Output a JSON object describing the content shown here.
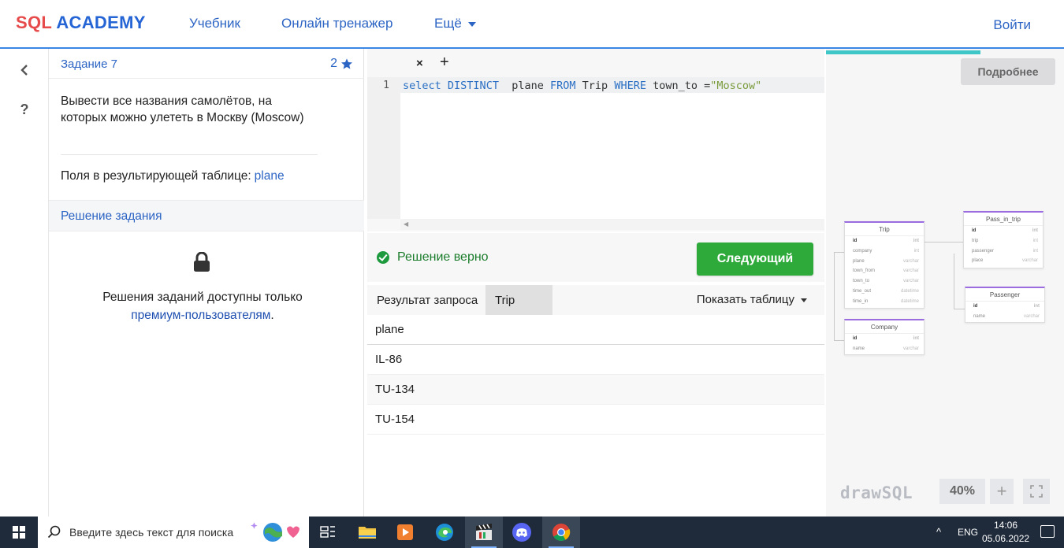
{
  "header": {
    "logo_sql": "SQL",
    "logo_academy": "ACADEMY",
    "nav": [
      "Учебник",
      "Онлайн тренажер",
      "Ещё"
    ],
    "login": "Войти"
  },
  "rail": {
    "back_glyph": "‹",
    "help_glyph": "?"
  },
  "task": {
    "title": "Задание 7",
    "points": "2",
    "description": "Вывести все названия самолётов, на которых можно улететь в Москву (Moscow)",
    "fields_label": "Поля в результирующей таблице:",
    "fields_value": "plane",
    "solution_title": "Решение задания",
    "premium_text": "Решения заданий доступны только",
    "premium_link": "премиум-пользователям",
    "premium_end": "."
  },
  "editor": {
    "tab_close": "×",
    "tab_add": "+",
    "line_number": "1",
    "code_kw1": "select",
    "code_kw2": "DISTINCT",
    "code_col": "plane",
    "code_kw3": "FROM",
    "code_table": "Trip",
    "code_kw4": "WHERE",
    "code_field": "town_to",
    "code_op": "=",
    "code_str": "\"Moscow\""
  },
  "status": {
    "message": "Решение верно",
    "next_button": "Следующий"
  },
  "results": {
    "tabs": [
      "Результат запроса",
      "Trip"
    ],
    "show_table": "Показать таблицу",
    "column": "plane",
    "rows": [
      "IL-86",
      "TU-134",
      "TU-154"
    ]
  },
  "diagram": {
    "more_button": "Подробнее",
    "brand_a": "drawSQL",
    "zoom": "40%",
    "zoom_in": "+",
    "tables": {
      "trip": {
        "name": "Trip",
        "fields": [
          "id",
          "company",
          "plane",
          "town_from",
          "town_to",
          "time_out",
          "time_in"
        ],
        "types": [
          "int",
          "int",
          "varchar",
          "varchar",
          "varchar",
          "datetime",
          "datetime"
        ]
      },
      "company": {
        "name": "Company",
        "fields": [
          "id",
          "name"
        ],
        "types": [
          "int",
          "varchar"
        ]
      },
      "pass_in_trip": {
        "name": "Pass_in_trip",
        "fields": [
          "id",
          "trip",
          "passenger",
          "place"
        ],
        "types": [
          "int",
          "int",
          "int",
          "varchar"
        ]
      },
      "passenger": {
        "name": "Passenger",
        "fields": [
          "id",
          "name"
        ],
        "types": [
          "int",
          "varchar"
        ]
      }
    }
  },
  "taskbar": {
    "search_placeholder": "Введите здесь текст для поиска",
    "lang": "ENG",
    "time": "14:06",
    "date": "05.06.2022",
    "tray_chevron": "^",
    "colors": {
      "accent": "#2eaa3a",
      "brand_blue": "#2464d4",
      "brand_red": "#e64a4a"
    }
  }
}
